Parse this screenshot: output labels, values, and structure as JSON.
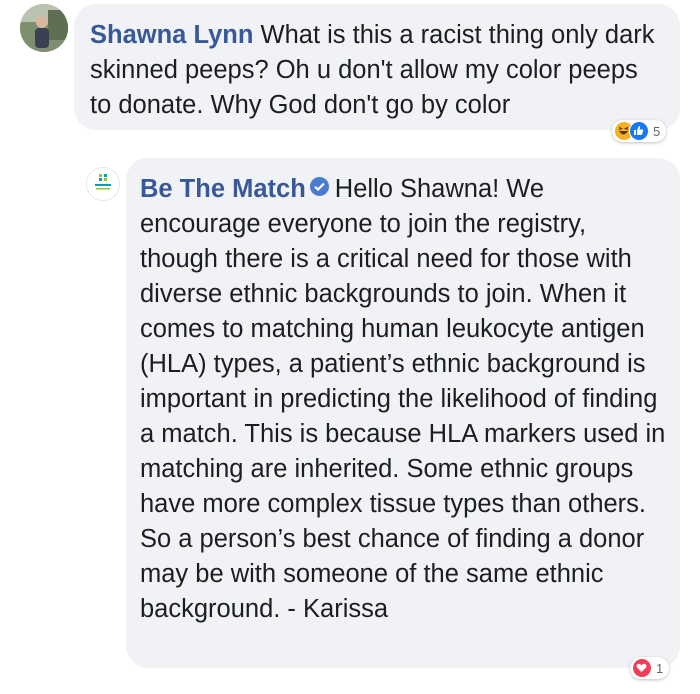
{
  "comment": {
    "author": "Shawna Lynn",
    "text": "What is this a racist thing only dark skinned peeps? Oh u don't allow my color peeps to donate. Why God don't go by color",
    "reactions": {
      "icons": [
        "haha-icon",
        "like-icon"
      ],
      "count": "5"
    }
  },
  "reply": {
    "author": "Be The Match",
    "verified": true,
    "text": "Hello Shawna! We encourage everyone to join the registry, though there is a critical need for those with diverse ethnic backgrounds to join. When it comes to matching human leukocyte antigen (HLA) types, a patient’s ethnic background is important in predicting the likelihood of finding a match. This is because HLA markers used in matching are inherited. Some ethnic groups have more complex tissue types than others. So a person’s best chance of finding a donor may be with someone of the same ethnic background. - Karissa",
    "reactions": {
      "icons": [
        "love-icon"
      ],
      "count": "1"
    }
  },
  "colors": {
    "author_link": "#385898",
    "bubble": "#f0f2f5",
    "verified": "#4a7bd0"
  }
}
